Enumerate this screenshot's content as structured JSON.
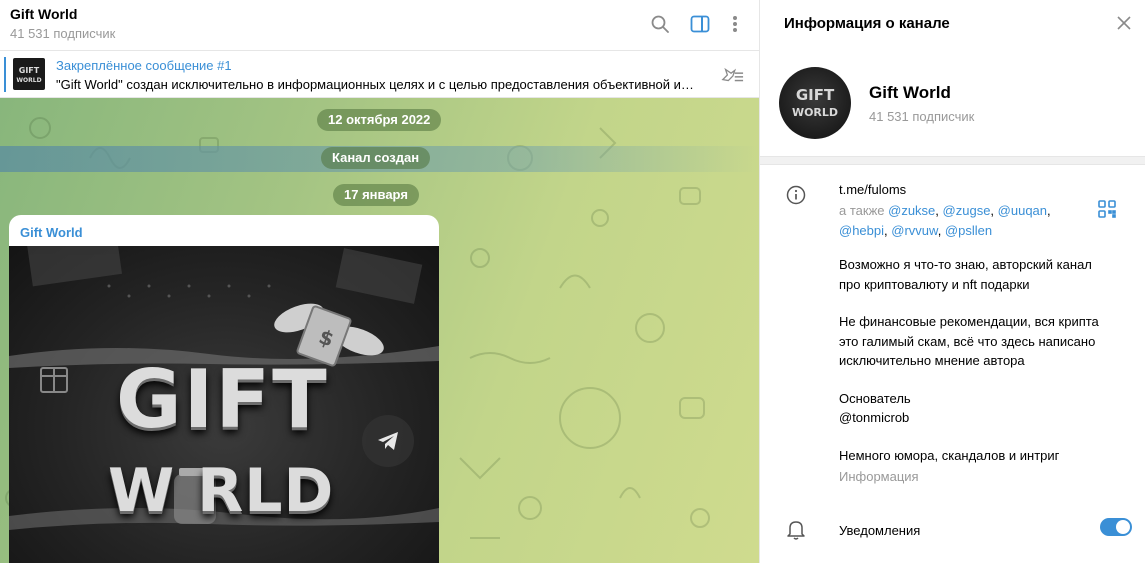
{
  "chat": {
    "title": "Gift World",
    "subscribers": "41 531 подписчик",
    "icons": [
      "search-icon",
      "sidebar-toggle-icon",
      "more-vertical-icon"
    ]
  },
  "pinned": {
    "title": "Закреплённое сообщение #1",
    "text": "\"Gift World\" создан исключительно в информационных целях и с целью предоставления объективной информации о рынке",
    "thumb_text": "GIFT WORLD"
  },
  "timeline": {
    "date1": "12 октября 2022",
    "created": "Канал создан",
    "date2": "17 января"
  },
  "message": {
    "author": "Gift World",
    "image_title_line1": "GIFT",
    "image_title_line2": "W  RLD"
  },
  "info": {
    "header": "Информация о канале",
    "name": "Gift World",
    "subscribers": "41 531 подписчик",
    "avatar_text1": "GIFT",
    "avatar_text2": "WORLD",
    "link": "t.me/fuloms",
    "also_prefix": "а также",
    "aliases": [
      "@zukse",
      "@zugse",
      "@uuqan",
      "@hebpi",
      "@rvvuw",
      "@psllen"
    ],
    "desc1_line1": "Возможно я что-то знаю, авторский канал",
    "desc1_line2": "про криптовалюту и nft подарки",
    "desc2_line1": "Не финансовые рекомендации, вся крипта",
    "desc2_line2": "это галимый скам, всё что здесь написано",
    "desc2_line3": "исключительно мнение автора",
    "founder_label": "Основатель",
    "founder": "@tonmicrob",
    "tagline": "Немного юмора, скандалов и интриг",
    "info_label": "Информация",
    "notifications_label": "Уведомления",
    "notifications_on": true
  },
  "colors": {
    "accent": "#3a8fd6",
    "chat_bg_start": "#88b67c",
    "chat_bg_end": "#cfdb8e"
  }
}
